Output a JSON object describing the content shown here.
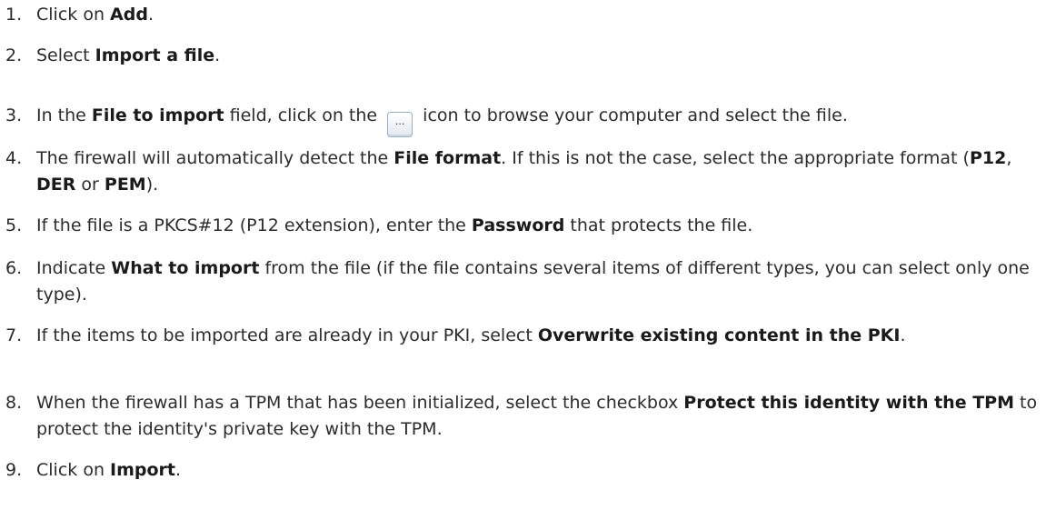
{
  "steps": [
    {
      "num": "1.",
      "parts": [
        {
          "t": "Click on "
        },
        {
          "t": "Add",
          "b": true
        },
        {
          "t": "."
        }
      ]
    },
    {
      "num": "2.",
      "parts": [
        {
          "t": "Select "
        },
        {
          "t": "Import a file",
          "b": true
        },
        {
          "t": "."
        }
      ]
    },
    {
      "num": "3.",
      "parts": [
        {
          "t": "In the "
        },
        {
          "t": "File to import",
          "b": true
        },
        {
          "t": " field, click on the "
        },
        {
          "icon": "browse-button"
        },
        {
          "t": " icon to browse your computer and select the file."
        }
      ]
    },
    {
      "num": "4.",
      "parts": [
        {
          "t": "The firewall will automatically detect the "
        },
        {
          "t": "File format",
          "b": true
        },
        {
          "t": ". If this is not the case, select the appropriate format ("
        },
        {
          "t": "P12",
          "b": true
        },
        {
          "t": ", "
        },
        {
          "t": "DER",
          "b": true
        },
        {
          "t": " or "
        },
        {
          "t": "PEM",
          "b": true
        },
        {
          "t": ")."
        }
      ]
    },
    {
      "num": "5.",
      "parts": [
        {
          "t": "If the file is a PKCS#12 (P12 extension), enter the "
        },
        {
          "t": "Password",
          "b": true
        },
        {
          "t": " that protects the file."
        }
      ]
    },
    {
      "num": "6.",
      "parts": [
        {
          "t": "Indicate "
        },
        {
          "t": "What to import",
          "b": true
        },
        {
          "t": " from the file (if the file contains several items of different types, you can select only one type)."
        }
      ]
    },
    {
      "num": "7.",
      "parts": [
        {
          "t": "If the items to be imported are already in your PKI, select "
        },
        {
          "t": "Overwrite existing content in the PKI",
          "b": true
        },
        {
          "t": "."
        }
      ]
    },
    {
      "num": "8.",
      "parts": [
        {
          "t": "When the firewall has a TPM that has been initialized, select the checkbox "
        },
        {
          "t": "Protect this identity with the TPM",
          "b": true
        },
        {
          "t": " to protect the identity's private key with the TPM."
        }
      ]
    },
    {
      "num": "9.",
      "parts": [
        {
          "t": "Click on "
        },
        {
          "t": "Import",
          "b": true
        },
        {
          "t": "."
        }
      ]
    }
  ],
  "icons": {
    "browse-button": {
      "label": "..."
    }
  }
}
